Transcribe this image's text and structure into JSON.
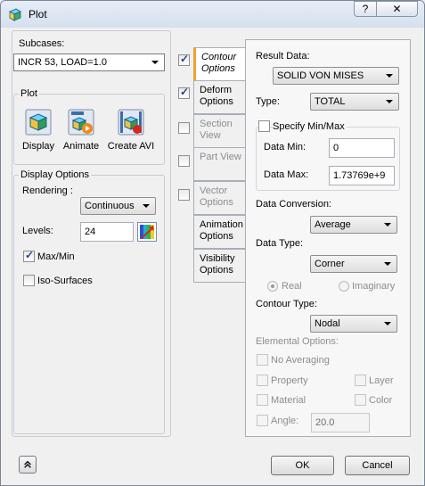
{
  "window": {
    "title": "Plot",
    "help_label": "?",
    "close_label": "✕"
  },
  "subcases": {
    "label": "Subcases:",
    "value": "INCR 53, LOAD=1.0"
  },
  "plot": {
    "label": "Plot",
    "display_label": "Display",
    "animate_label": "Animate",
    "create_avi_label": "Create AVI"
  },
  "display_options": {
    "label": "Display Options",
    "rendering_label": "Rendering :",
    "rendering_value": "Continuous",
    "levels_label": "Levels:",
    "levels_value": "24",
    "maxmin_label": "Max/Min",
    "maxmin_checked": true,
    "isosurfaces_label": "Iso-Surfaces",
    "isosurfaces_checked": false
  },
  "tabs": [
    {
      "label": "Contour Options",
      "checked": true,
      "active": true,
      "enabled": true,
      "has_checkbox": true
    },
    {
      "label": "Deform Options",
      "checked": true,
      "active": false,
      "enabled": true,
      "has_checkbox": true
    },
    {
      "label": "Section View",
      "checked": false,
      "active": false,
      "enabled": false,
      "has_checkbox": true
    },
    {
      "label": "Part View",
      "checked": false,
      "active": false,
      "enabled": false,
      "has_checkbox": true
    },
    {
      "label": "Vector Options",
      "checked": false,
      "active": false,
      "enabled": false,
      "has_checkbox": true
    },
    {
      "label": "Animation Options",
      "active": false,
      "enabled": true,
      "has_checkbox": false
    },
    {
      "label": "Visibility Options",
      "active": false,
      "enabled": true,
      "has_checkbox": false
    }
  ],
  "contour": {
    "result_data_label": "Result Data:",
    "result_data_value": "SOLID VON MISES",
    "type_label": "Type:",
    "type_value": "TOTAL",
    "specify_minmax_label": "Specify Min/Max",
    "specify_minmax_checked": false,
    "data_min_label": "Data Min:",
    "data_min_value": "0",
    "data_max_label": "Data Max:",
    "data_max_value": "1.73769e+9",
    "data_conversion_label": "Data Conversion:",
    "data_conversion_value": "Average",
    "data_type_label": "Data Type:",
    "data_type_value": "Corner",
    "real_label": "Real",
    "imaginary_label": "Imaginary",
    "contour_type_label": "Contour Type:",
    "contour_type_value": "Nodal",
    "elemental_options_label": "Elemental Options:",
    "no_averaging_label": "No Averaging",
    "property_label": "Property",
    "layer_label": "Layer",
    "material_label": "Material",
    "color_label": "Color",
    "angle_label": "Angle:",
    "angle_value": "20.0"
  },
  "footer": {
    "ok_label": "OK",
    "cancel_label": "Cancel",
    "collapse_icon": "double-chevron-up-icon"
  },
  "colors": {
    "accent": "#f0a030",
    "check": "#2a3f8e"
  }
}
